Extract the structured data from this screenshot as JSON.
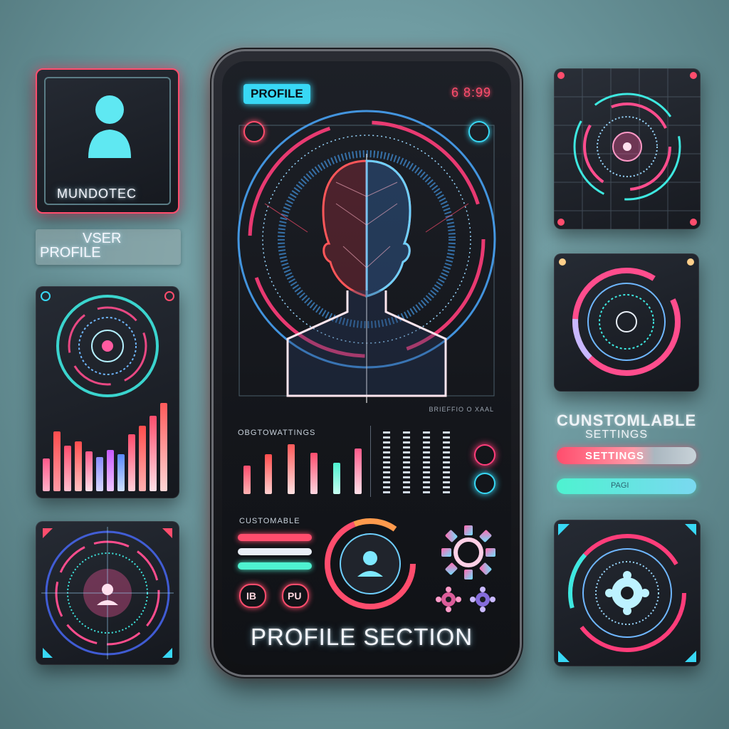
{
  "phone": {
    "badge": "PROFILE",
    "time": "6 8:99",
    "small_code": "BRIEFFIO O XAAL",
    "settings_label": "OBGTOWATTINGS",
    "customizable_label": "CUSTOMABLE",
    "footer_title": "PROFILE SECTION",
    "icon_left_1": "IB",
    "icon_left_2": "PU"
  },
  "left": {
    "avatar_caption": "MUNDOTEC",
    "user_line1": "VSER",
    "user_line2": "PROFILE"
  },
  "right": {
    "title_line1": "CUNSTOMLABLE",
    "title_line2": "SETTINGS",
    "toggle1_label": "SETTINGS",
    "toggle2_label": "PAGI"
  },
  "colors": {
    "accent_cyan": "#38d8f5",
    "accent_pink": "#ff3d7a",
    "accent_red": "#ff4d4d",
    "accent_teal": "#4ef2d0"
  }
}
